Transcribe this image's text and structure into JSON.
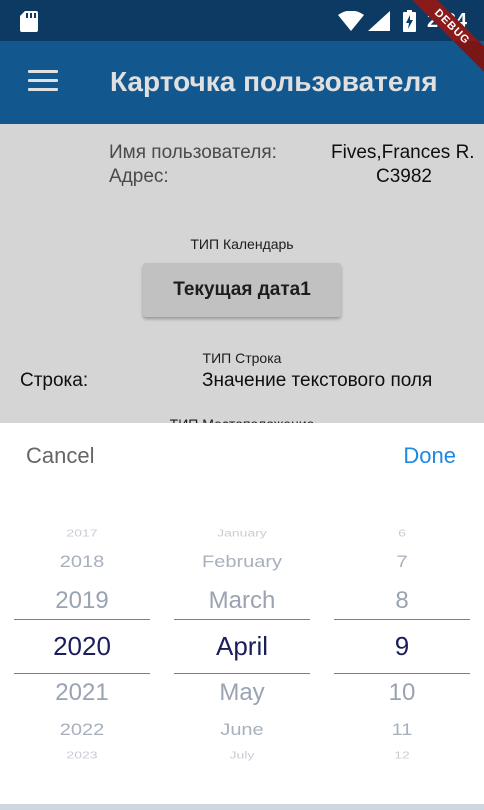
{
  "status_bar": {
    "time": "2:34"
  },
  "app_bar": {
    "title": "Карточка пользователя",
    "debug_banner": "DEBUG"
  },
  "user": {
    "name_label": "Имя пользователя:",
    "name_value": "Fives,Frances R.",
    "address_label": "Адрес:",
    "address_value": "C3982"
  },
  "calendar_section": {
    "caption": "ТИП Календарь",
    "button_label": "Текущая дата1"
  },
  "string_section": {
    "caption": "ТИП Строка",
    "label": "Строка:",
    "value": "Значение текстового поля"
  },
  "location_section": {
    "caption": "ТИП Местоположение"
  },
  "picker": {
    "cancel_label": "Cancel",
    "done_label": "Done",
    "years": [
      "2017",
      "2018",
      "2019",
      "2020",
      "2021",
      "2022",
      "2023"
    ],
    "months": [
      "January",
      "February",
      "March",
      "April",
      "May",
      "June",
      "July"
    ],
    "days": [
      "6",
      "7",
      "8",
      "9",
      "10",
      "11",
      "12"
    ],
    "selected": {
      "year": "2020",
      "month": "April",
      "day": "9"
    }
  },
  "colors": {
    "app_bar": "#1565a3",
    "status_bar": "#0c3a63",
    "done": "#1e88e5",
    "selected_text": "#1a1f5a"
  }
}
